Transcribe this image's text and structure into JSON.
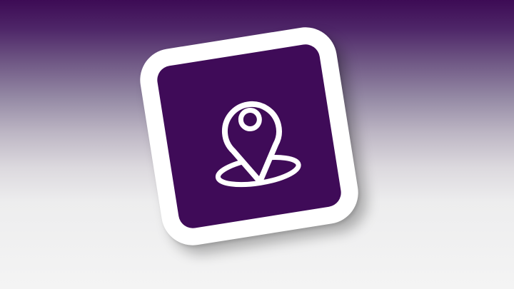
{
  "icon": {
    "name": "map-location-pin-icon",
    "tile_color": "#ffffff",
    "inner_color": "#3f0b58",
    "glyph_color": "#ffffff"
  },
  "background": {
    "top_color": "#3d0b55",
    "bottom_color": "#f4f4f4"
  }
}
